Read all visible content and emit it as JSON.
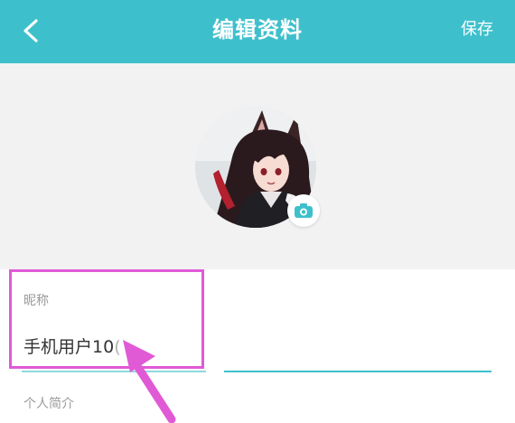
{
  "header": {
    "back_icon": "chevron-left-icon",
    "title": "编辑资料",
    "save_label": "保存",
    "background_color": "#3ec0cc"
  },
  "avatar": {
    "camera_icon": "camera-icon"
  },
  "nickname": {
    "label": "昵称",
    "value_visible": "手机用户10",
    "value_faded": "("
  },
  "bio": {
    "label": "个人简介"
  },
  "annotation": {
    "highlight_color": "#e05ad6",
    "arrow_icon": "pointer-arrow-icon"
  }
}
